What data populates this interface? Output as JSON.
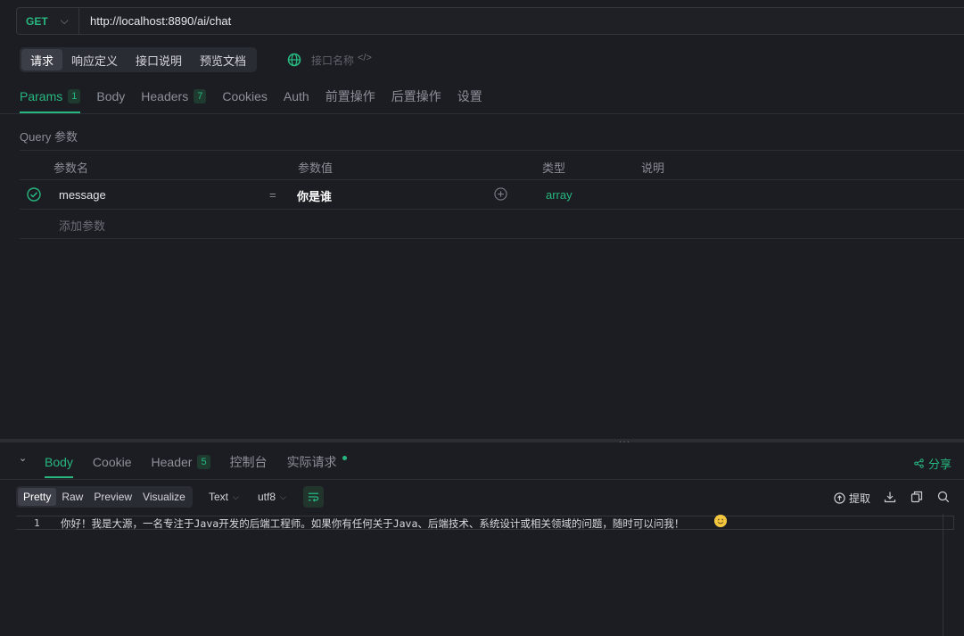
{
  "request": {
    "method": "GET",
    "url": "http://localhost:8890/ai/chat"
  },
  "segments": [
    "请求",
    "响应定义",
    "接口说明",
    "预览文档"
  ],
  "api_name_placeholder": "接口名称",
  "req_tabs": [
    {
      "label": "Params",
      "badge": "1"
    },
    {
      "label": "Body",
      "badge": ""
    },
    {
      "label": "Headers",
      "badge": "7"
    },
    {
      "label": "Cookies",
      "badge": ""
    },
    {
      "label": "Auth",
      "badge": ""
    },
    {
      "label": "前置操作",
      "badge": ""
    },
    {
      "label": "后置操作",
      "badge": ""
    },
    {
      "label": "设置",
      "badge": ""
    }
  ],
  "query_label": "Query 参数",
  "table": {
    "headers": [
      "参数名",
      "参数值",
      "类型",
      "说明"
    ],
    "rows": [
      {
        "name": "message",
        "eq": "=",
        "value": "你是谁",
        "type": "array",
        "desc": ""
      }
    ],
    "add_placeholder": "添加参数"
  },
  "resp_tabs": [
    {
      "label": "Body",
      "badge": ""
    },
    {
      "label": "Cookie",
      "badge": ""
    },
    {
      "label": "Header",
      "badge": "5"
    },
    {
      "label": "控制台",
      "badge": ""
    },
    {
      "label": "实际请求",
      "badge": ""
    }
  ],
  "share_label": "分享",
  "format_tabs": [
    "Pretty",
    "Raw",
    "Preview",
    "Visualize"
  ],
  "format_type": "Text",
  "encoding": "utf8",
  "extract_label": "提取",
  "editor": {
    "line_number": "1",
    "content": "你好！我是大源，一名专注于Java开发的后端工程师。如果你有任何关于Java、后端技术、系统设计或相关领域的问题，随时可以问我！"
  },
  "colors": {
    "accent": "#27b77f",
    "background": "#1c1d22"
  }
}
